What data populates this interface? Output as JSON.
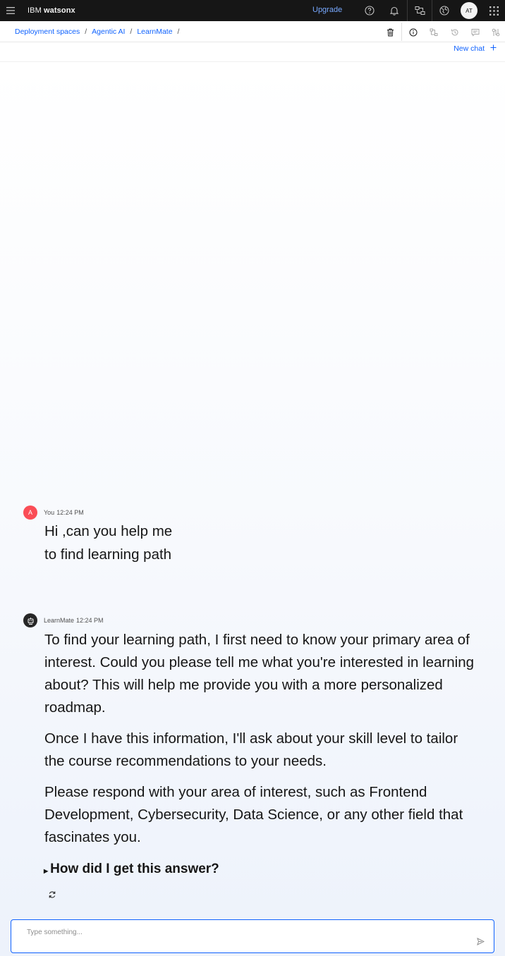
{
  "header": {
    "brand_prefix": "IBM",
    "brand_name": "watsonx",
    "upgrade_label": "Upgrade",
    "avatar_initials": "AT",
    "icons": [
      "menu-icon",
      "help-icon",
      "notification-icon",
      "switcher-icon",
      "globe-icon",
      "app-switcher-icon"
    ]
  },
  "breadcrumb": {
    "items": [
      "Deployment spaces",
      "Agentic AI",
      "LearnMate"
    ],
    "separator": "/"
  },
  "toolbar": {
    "icons": [
      "trash-icon",
      "info-icon",
      "flow-icon",
      "history-icon",
      "chat-icon",
      "settings-icon"
    ]
  },
  "new_chat": {
    "label": "New chat",
    "icon": "plus-icon"
  },
  "messages": [
    {
      "author": "You",
      "time": "12:24 PM",
      "avatar": "A",
      "paragraphs": [
        "Hi ,can you help me to find learning path"
      ]
    },
    {
      "author": "LearnMate",
      "time": "12:24 PM",
      "paragraphs": [
        "To find your learning path, I first need to know your primary area of interest. Could you please tell me what you're interested in learning about? This will help me provide you with a more personalized roadmap.",
        "Once I have this information, I'll ask about your skill level to tailor the course recommendations to your needs.",
        "Please respond with your area of interest, such as Frontend Development, Cybersecurity, Data Science, or any other field that fascinates you."
      ],
      "disclosure": "How did I get this answer?"
    }
  ],
  "composer": {
    "placeholder": "Type something...",
    "value": ""
  },
  "colors": {
    "top_bar": "#161616",
    "link": "#0f62fe",
    "upgrade": "#78a9ff",
    "user_avatar": "#fa4d56",
    "bot_avatar": "#262626"
  }
}
